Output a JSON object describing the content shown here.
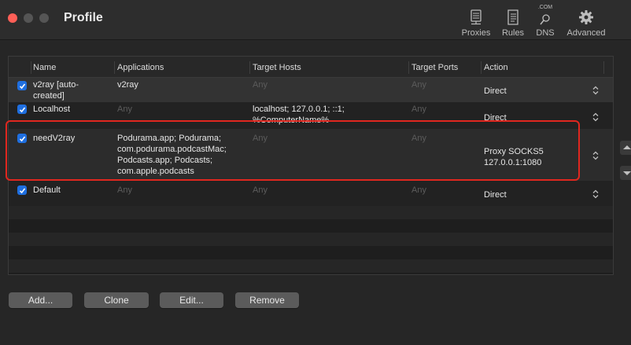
{
  "window": {
    "title": "Profile"
  },
  "toolbar": {
    "proxies_label": "Proxies",
    "rules_label": "Rules",
    "dns_label": "DNS",
    "dns_icon_text": ".COM",
    "advanced_label": "Advanced"
  },
  "table": {
    "headers": {
      "name": "Name",
      "applications": "Applications",
      "target_hosts": "Target Hosts",
      "target_ports": "Target Ports",
      "action": "Action"
    },
    "rows": [
      {
        "checked": true,
        "name_line1": "v2ray [auto-",
        "name_line2": "created]",
        "applications": "v2ray",
        "target_hosts": "Any",
        "target_ports": "Any",
        "action": "Direct"
      },
      {
        "checked": true,
        "name": "Localhost",
        "applications": "Any",
        "target_hosts_line1": "localhost; 127.0.0.1; ::1;",
        "target_hosts_line2": "%ComputerName%",
        "target_ports": "Any",
        "action": "Direct"
      },
      {
        "checked": true,
        "name": "needV2ray",
        "applications_lines": [
          "Podurama.app; Podurama;",
          "com.podurama.podcastMac;",
          "Podcasts.app; Podcasts;",
          "com.apple.podcasts"
        ],
        "target_hosts": "Any",
        "target_ports": "Any",
        "action_line1": "Proxy SOCKS5",
        "action_line2": "127.0.0.1:1080"
      },
      {
        "checked": true,
        "name": "Default",
        "applications": "Any",
        "target_hosts": "Any",
        "target_ports": "Any",
        "action": "Direct"
      }
    ]
  },
  "buttons": {
    "add": "Add...",
    "clone": "Clone",
    "edit": "Edit...",
    "remove": "Remove"
  },
  "colors": {
    "highlight": "#e0271f",
    "checkbox": "#1f6fe0",
    "close": "#ff5f57"
  }
}
